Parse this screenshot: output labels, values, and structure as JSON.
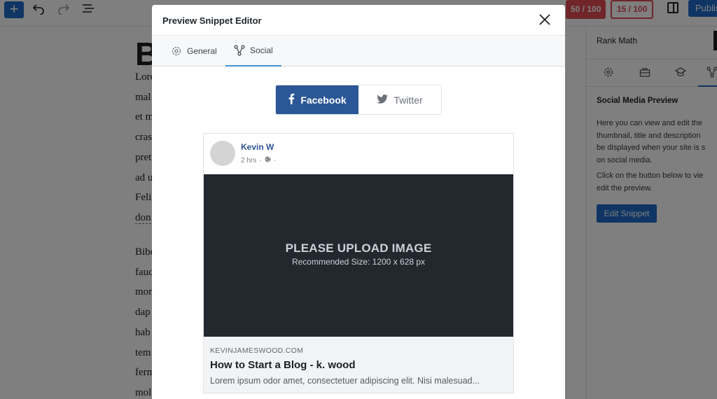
{
  "editor": {
    "heading_letter": "B",
    "para1": [
      "Lore",
      "mal",
      "et m",
      "cras",
      "pret",
      "ad u",
      "Feli",
      "don"
    ],
    "para2": [
      "Bibe",
      "fauc",
      "mor",
      "dap",
      "hab",
      "tem",
      "ferm",
      "mol"
    ]
  },
  "toolbar": {
    "plus": "+",
    "seo_score": "50 / 100",
    "readability_score": "15 / 100",
    "publish_label": "Publis"
  },
  "sidebar": {
    "title": "Rank Math",
    "heading": "Social Media Preview",
    "description_lines": [
      "Here you can view and edit the",
      "thumbnail, title and description",
      "be displayed when your site is s",
      "on social media."
    ],
    "instruction_lines": [
      "Click on the button below to vie",
      "edit the preview."
    ],
    "edit_button": "Edit Snippet"
  },
  "modal": {
    "title": "Preview Snippet Editor",
    "tabs": [
      {
        "label": "General"
      },
      {
        "label": "Social"
      }
    ],
    "active_tab": "Social"
  },
  "network_toggle": {
    "facebook_label": "Facebook",
    "twitter_label": "Twitter",
    "selected": "Facebook"
  },
  "preview_card": {
    "author": "Kevin W",
    "time": "2 hrs",
    "dot": "·",
    "image_title": "PLEASE UPLOAD IMAGE",
    "image_subtitle": "Recommended Size: 1200 x 628 px",
    "domain": "KEVINJAMESWOOD.COM",
    "link_title": "How to Start a Blog - k. wood",
    "link_description": "Lorem ipsum odor amet, consectetuer adipiscing elit. Nisi malesuad..."
  },
  "colors": {
    "facebook_blue": "#2b5796",
    "wp_blue": "#1e6ac9",
    "score_red": "#e04a52",
    "image_bg": "#23272e"
  }
}
